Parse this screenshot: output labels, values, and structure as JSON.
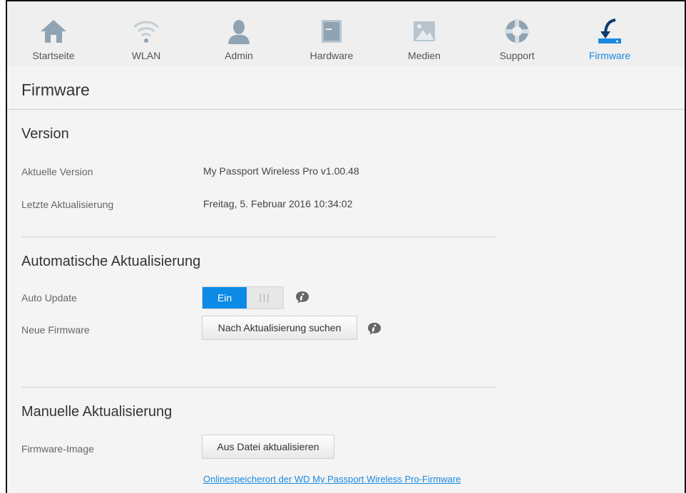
{
  "nav": {
    "items": [
      {
        "label": "Startseite",
        "icon": "home-icon"
      },
      {
        "label": "WLAN",
        "icon": "wifi-icon"
      },
      {
        "label": "Admin",
        "icon": "user-icon"
      },
      {
        "label": "Hardware",
        "icon": "hardware-icon"
      },
      {
        "label": "Medien",
        "icon": "media-icon"
      },
      {
        "label": "Support",
        "icon": "lifebuoy-icon"
      },
      {
        "label": "Firmware",
        "icon": "firmware-download-icon"
      }
    ],
    "active": "Firmware",
    "accent_color": "#1a8ae0"
  },
  "page": {
    "title": "Firmware"
  },
  "version": {
    "title": "Version",
    "current_label": "Aktuelle Version",
    "current_value": "My Passport Wireless Pro v1.00.48",
    "last_update_label": "Letzte Aktualisierung",
    "last_update_value": "Freitag, 5. Februar 2016 10:34:02"
  },
  "auto_update": {
    "title": "Automatische Aktualisierung",
    "auto_label": "Auto Update",
    "toggle_on_label": "Ein",
    "toggle_state": true,
    "new_fw_label": "Neue Firmware",
    "check_button": "Nach Aktualisierung suchen"
  },
  "manual_update": {
    "title": "Manuelle Aktualisierung",
    "image_label": "Firmware-Image",
    "file_button": "Aus Datei aktualisieren",
    "online_link": "Onlinespeicherort der WD My Passport Wireless Pro-Firmware"
  }
}
